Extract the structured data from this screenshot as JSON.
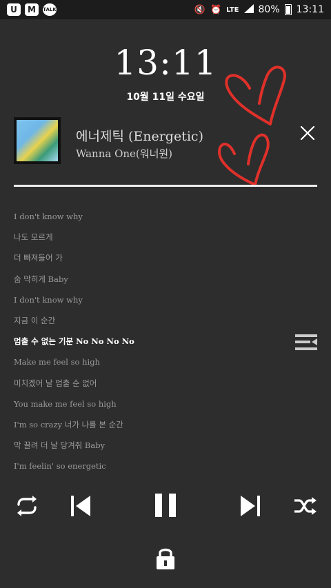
{
  "status_bar": {
    "apps": [
      "U",
      "M",
      "TALK"
    ],
    "network": "LTE",
    "battery": "80%",
    "time": "13:11"
  },
  "lockscreen": {
    "clock": "13:11",
    "date": "10월 11일 수요일"
  },
  "player": {
    "title": "에너제틱 (Energetic)",
    "artist": "Wanna One(워너원)",
    "progress": 1.0,
    "lyrics": [
      "I don't know why",
      "나도 모르게",
      "더 빠져들어 가",
      "숨 막히게 Baby",
      "I don't know why",
      "지금 이 순간",
      "멈출 수 없는 기분 No No No No",
      "Make me feel so high",
      "미치겠어 날 멈출 순 없어",
      "You make me feel so high",
      "I'm so crazy 너가 나를 본 순간",
      "막 끌려 더 날 당겨줘 Baby",
      "I'm feelin' so energetic"
    ],
    "current_line_index": 6
  },
  "colors": {
    "background": "#2d2d2d",
    "status_bar": "#1c1c1c",
    "lyric_dim": "#9b9b9b",
    "lyric_current": "#ffffff",
    "heart_stroke": "#e0302a"
  },
  "icons": {
    "close": "close-icon",
    "lyrics_menu": "playlist-icon",
    "repeat": "repeat-icon",
    "previous": "skip-previous-icon",
    "pause": "pause-icon",
    "next": "skip-next-icon",
    "shuffle": "shuffle-icon",
    "lock": "lock-icon"
  }
}
